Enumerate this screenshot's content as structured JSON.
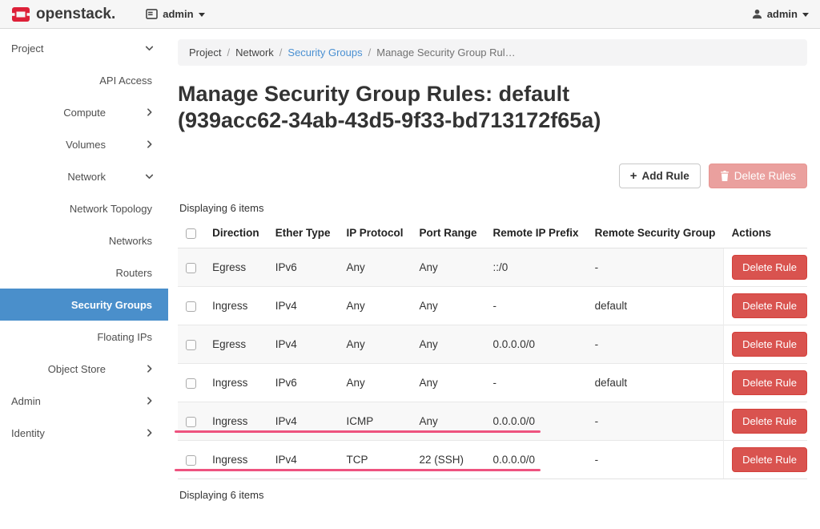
{
  "header": {
    "brand": "openstack.",
    "project_switcher": {
      "label": "admin"
    },
    "user_menu": {
      "label": "admin"
    }
  },
  "sidebar": {
    "items": [
      {
        "label": "Project",
        "level": 1,
        "chevron": "down",
        "selected": false
      },
      {
        "label": "API Access",
        "level": 3,
        "chevron": null,
        "selected": false
      },
      {
        "label": "Compute",
        "level": 2,
        "chevron": "right",
        "selected": false
      },
      {
        "label": "Volumes",
        "level": 2,
        "chevron": "right",
        "selected": false
      },
      {
        "label": "Network",
        "level": 2,
        "chevron": "down",
        "selected": false
      },
      {
        "label": "Network Topology",
        "level": 3,
        "chevron": null,
        "selected": false
      },
      {
        "label": "Networks",
        "level": 3,
        "chevron": null,
        "selected": false
      },
      {
        "label": "Routers",
        "level": 3,
        "chevron": null,
        "selected": false
      },
      {
        "label": "Security Groups",
        "level": 3,
        "chevron": null,
        "selected": true
      },
      {
        "label": "Floating IPs",
        "level": 3,
        "chevron": null,
        "selected": false
      },
      {
        "label": "Object Store",
        "level": 2,
        "chevron": "right",
        "selected": false
      },
      {
        "label": "Admin",
        "level": 1,
        "chevron": "right",
        "selected": false
      },
      {
        "label": "Identity",
        "level": 1,
        "chevron": "right",
        "selected": false
      }
    ]
  },
  "breadcrumb": {
    "items": [
      {
        "label": "Project",
        "type": "text"
      },
      {
        "label": "Network",
        "type": "text"
      },
      {
        "label": "Security Groups",
        "type": "link"
      },
      {
        "label": "Manage Security Group Rul…",
        "type": "current"
      }
    ]
  },
  "page": {
    "title": "Manage Security Group Rules: default (939acc62-34ab-43d5-9f33-bd713172f65a)"
  },
  "toolbar": {
    "add_rule_label": "Add Rule",
    "delete_rules_label": "Delete Rules"
  },
  "table": {
    "count_top": "Displaying 6 items",
    "count_bottom": "Displaying 6 items",
    "columns": [
      "Direction",
      "Ether Type",
      "IP Protocol",
      "Port Range",
      "Remote IP Prefix",
      "Remote Security Group",
      "Actions"
    ],
    "row_action_label": "Delete Rule",
    "rows": [
      {
        "direction": "Egress",
        "ether_type": "IPv6",
        "ip_protocol": "Any",
        "port_range": "Any",
        "remote_ip_prefix": "::/0",
        "remote_security_group": "-",
        "underlined": false
      },
      {
        "direction": "Ingress",
        "ether_type": "IPv4",
        "ip_protocol": "Any",
        "port_range": "Any",
        "remote_ip_prefix": "-",
        "remote_security_group": "default",
        "underlined": false
      },
      {
        "direction": "Egress",
        "ether_type": "IPv4",
        "ip_protocol": "Any",
        "port_range": "Any",
        "remote_ip_prefix": "0.0.0.0/0",
        "remote_security_group": "-",
        "underlined": false
      },
      {
        "direction": "Ingress",
        "ether_type": "IPv6",
        "ip_protocol": "Any",
        "port_range": "Any",
        "remote_ip_prefix": "-",
        "remote_security_group": "default",
        "underlined": false
      },
      {
        "direction": "Ingress",
        "ether_type": "IPv4",
        "ip_protocol": "ICMP",
        "port_range": "Any",
        "remote_ip_prefix": "0.0.0.0/0",
        "remote_security_group": "-",
        "underlined": true
      },
      {
        "direction": "Ingress",
        "ether_type": "IPv4",
        "ip_protocol": "TCP",
        "port_range": "22 (SSH)",
        "remote_ip_prefix": "0.0.0.0/0",
        "remote_security_group": "-",
        "underlined": true
      }
    ]
  },
  "colors": {
    "brand_red": "#dd2038",
    "sidebar_selected_blue": "#4a8fcb",
    "link_blue": "#4a90d2",
    "danger_red": "#d9534f",
    "annotation_pink": "#ee537f"
  }
}
